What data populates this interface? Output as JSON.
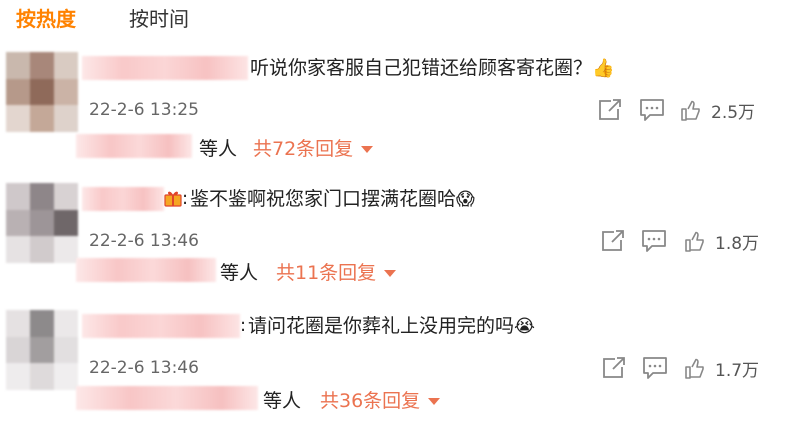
{
  "tabs": {
    "hot": "按热度",
    "time": "按时间"
  },
  "comments": [
    {
      "text": "听说你家客服自己犯错还给顾客寄花圈？",
      "emoji": "👍",
      "time": "22-2-6 13:25",
      "likes": "2.5万",
      "deng": "等人",
      "replies": "共72条回复"
    },
    {
      "prefix": ":",
      "text": "鉴不鉴啊祝您家门口摆满花圈哈",
      "emoji": "😱",
      "time": "22-2-6 13:46",
      "likes": "1.8万",
      "deng": "等人",
      "replies": "共11条回复"
    },
    {
      "prefix": ":",
      "text": "请问花圈是你葬礼上没用完的吗",
      "emoji": "😭",
      "time": "22-2-6 13:46",
      "likes": "1.7万",
      "deng": "等人",
      "replies": "共36条回复"
    }
  ],
  "icons": {
    "share": "share-icon",
    "comment": "comment-icon",
    "like": "thumbs-up-icon",
    "gift": "gift-icon",
    "caret": "chevron-down-icon"
  },
  "colors": {
    "accent": "#ff8200",
    "reply_link": "#eb7350"
  }
}
